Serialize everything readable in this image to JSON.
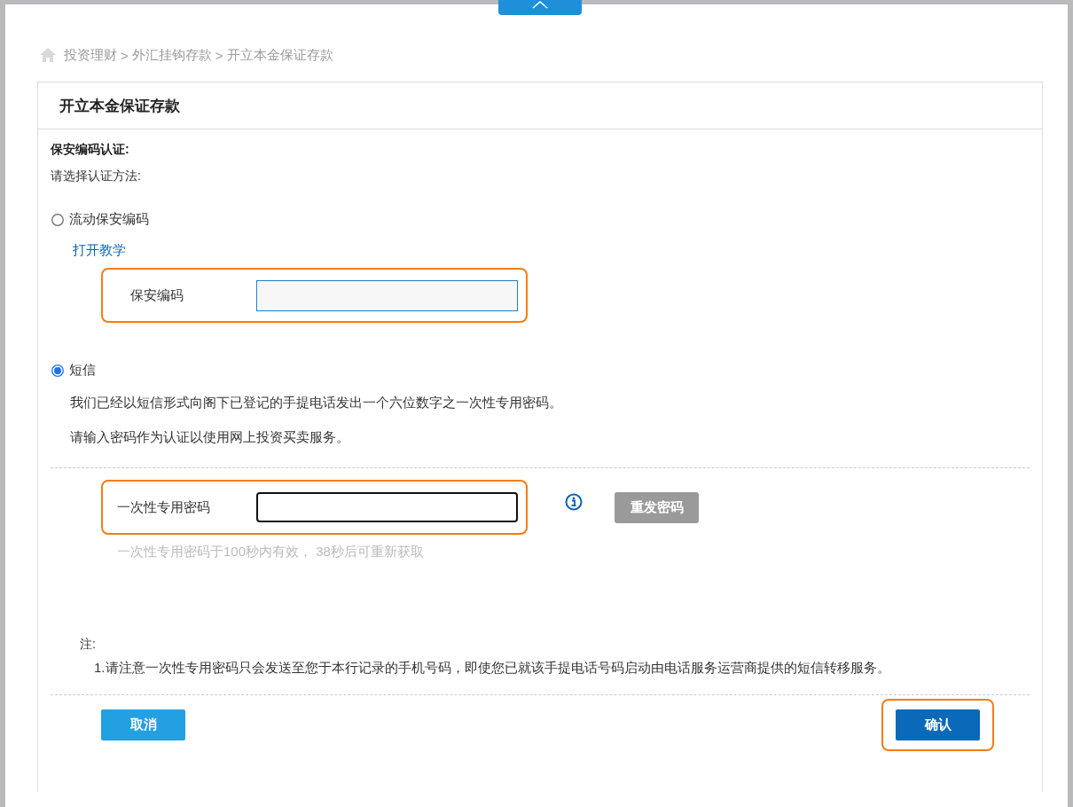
{
  "breadcrumb": [
    {
      "label": "投资理财",
      "separator": ">"
    },
    {
      "label": "外汇挂钩存款",
      "separator": ">"
    },
    {
      "label": "开立本金保证存款"
    }
  ],
  "card": {
    "title": "开立本金保证存款",
    "section_heading": "保安编码认证:",
    "prompt": "请选择认证方法:",
    "methods": [
      {
        "label": "流动保安编码",
        "selected": false,
        "link": "打开教学",
        "field": {
          "label": "保安编码",
          "kind": "token",
          "highlighted": true
        }
      },
      {
        "label": "短信",
        "selected": true,
        "paragraphs": [
          "我们已经以短信形式向阁下已登记的手提电话发出一个六位数字之一次性专用密码。",
          "请输入密码作为认证以使用网上投资买卖服务。"
        ]
      }
    ],
    "otp": {
      "label": "一次性专用密码",
      "kind": "otp",
      "highlighted": true,
      "resend_button": {
        "label": "重发密码",
        "disabled": true
      },
      "hint": "一次性专用密码于100秒内有效， 38秒后可重新获取"
    },
    "note": {
      "heading": "注:",
      "items": [
        "1.请注意一次性专用密码只会发送至您于本行记录的手机号码，即使您已就该手提电话号码启动由电话服务运营商提供的短信转移服务。"
      ]
    },
    "buttons": [
      {
        "label": "取消",
        "kind": "secondary",
        "highlighted": false
      },
      {
        "label": "确认",
        "kind": "primary",
        "highlighted": true
      }
    ]
  }
}
